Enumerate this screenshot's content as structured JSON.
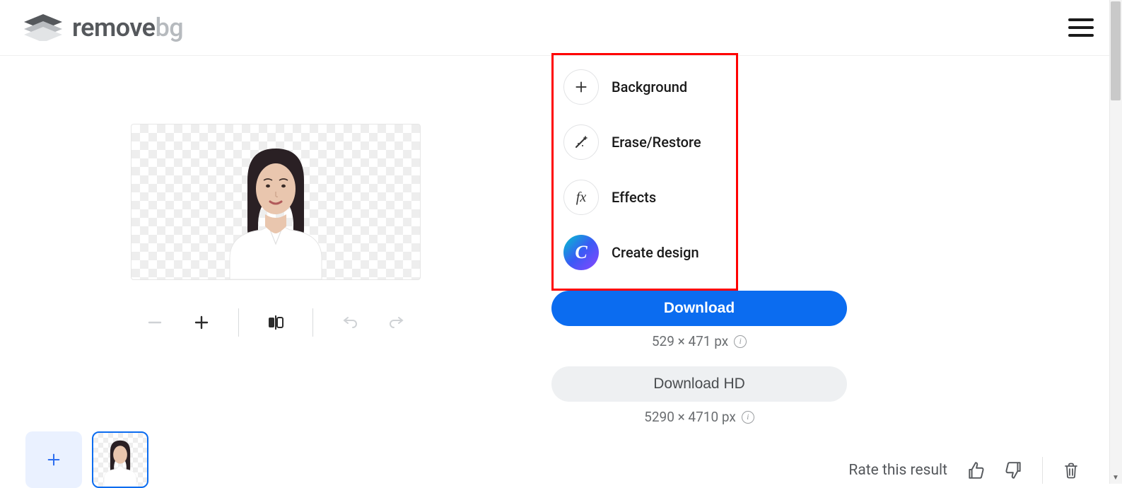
{
  "header": {
    "logo_text_main": "remove",
    "logo_text_suffix": "bg"
  },
  "actions": {
    "background": "Background",
    "erase_restore": "Erase/Restore",
    "effects": "Effects",
    "create_design": "Create design",
    "canva_glyph": "C",
    "fx_glyph": "fx"
  },
  "download": {
    "primary_label": "Download",
    "primary_size": "529 × 471 px",
    "secondary_label": "Download HD",
    "secondary_size": "5290 × 4710 px"
  },
  "feedback": {
    "rate_label": "Rate this result"
  }
}
